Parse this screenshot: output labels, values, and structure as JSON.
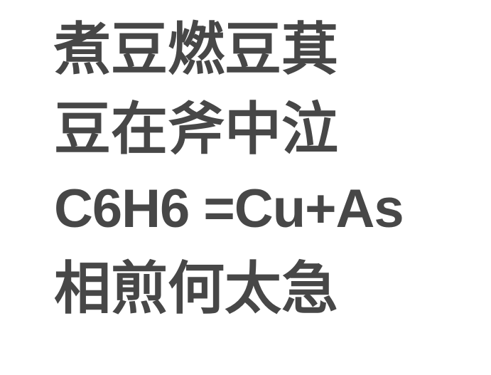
{
  "lines": [
    "煮豆燃豆萁",
    "豆在斧中泣",
    "C6H6 =Cu+As",
    "相煎何太急"
  ],
  "colors": {
    "text": "#474747",
    "background": "#ffffff"
  }
}
